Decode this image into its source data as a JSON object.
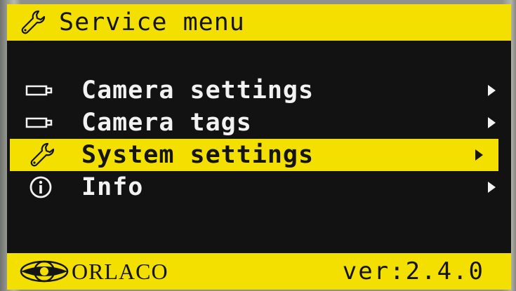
{
  "header": {
    "title": "Service menu",
    "icon": "wrench-icon"
  },
  "menu": {
    "items": [
      {
        "label": "Camera settings",
        "icon": "camera-icon",
        "selected": false
      },
      {
        "label": "Camera tags",
        "icon": "camera-icon",
        "selected": false
      },
      {
        "label": "System settings",
        "icon": "wrench-icon",
        "selected": true
      },
      {
        "label": "Info",
        "icon": "info-icon",
        "selected": false
      }
    ]
  },
  "footer": {
    "brand": "ORLACO",
    "version": "ver:2.4.0",
    "logo_icon": "orlaco-logo"
  },
  "colors": {
    "accent": "#f3e000",
    "background": "#121212",
    "text": "#f2f2f2"
  }
}
